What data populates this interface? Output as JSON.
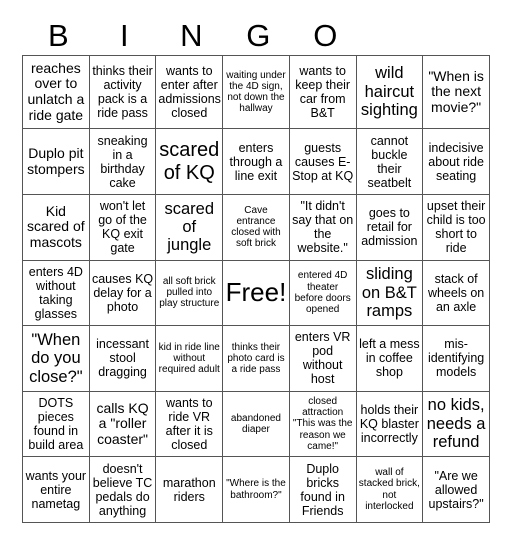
{
  "header": {
    "letters": [
      "B",
      "I",
      "N",
      "G",
      "O"
    ]
  },
  "grid": {
    "rows": [
      [
        "reaches over to unlatch a ride gate",
        "thinks their activity pack is a ride pass",
        "wants to enter after admissions closed",
        "waiting under the 4D sign, not down the hallway",
        "wants to keep their car from B&T",
        "wild haircut sighting",
        "\"When is the next movie?\""
      ],
      [
        "Duplo pit stompers",
        "sneaking in a birthday cake",
        "scared of KQ",
        "enters through a line exit",
        "guests causes E-Stop at KQ",
        "cannot buckle their seatbelt",
        "indecisive about ride seating"
      ],
      [
        "Kid scared of mascots",
        "won't let go of the KQ exit gate",
        "scared of jungle",
        "Cave entrance closed with soft brick",
        "\"It didn't say that on the website.\"",
        "goes to retail for admission",
        "upset their child is too short to ride"
      ],
      [
        "enters 4D without taking glasses",
        "causes KQ delay for a photo",
        "all soft brick pulled into play structure",
        "Free!",
        "entered 4D theater before doors opened",
        "sliding on B&T ramps",
        "stack of wheels on an axle"
      ],
      [
        "\"When do you close?\"",
        "incessant stool dragging",
        "kid in ride line without required adult",
        "thinks their photo card is a ride pass",
        "enters VR pod without host",
        "left a mess in coffee shop",
        "mis-identifying models"
      ],
      [
        "DOTS pieces found in build area",
        "calls KQ a \"roller coaster\"",
        "wants to ride VR after it is closed",
        "abandoned diaper",
        "closed attraction \"This was the reason we came!\"",
        "holds their KQ blaster incorrectly",
        "no kids, needs a refund"
      ],
      [
        "wants your entire nametag",
        "doesn't believe TC pedals do anything",
        "marathon riders",
        "\"Where is the bathroom?\"",
        "Duplo bricks found in Friends",
        "wall of stacked brick, not interlocked",
        "\"Are we allowed upstairs?\""
      ]
    ]
  }
}
